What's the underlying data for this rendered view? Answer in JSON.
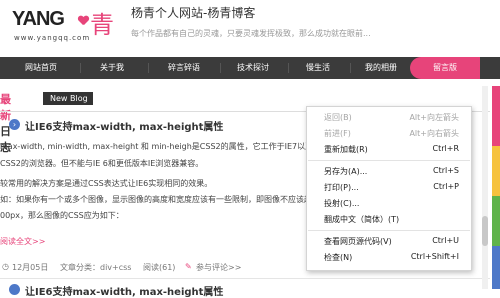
{
  "header": {
    "logo_text": "YANG",
    "logo_char": "青",
    "logo_url": "www.yangqq.com",
    "title": "杨青个人网站-杨青博客",
    "subtitle": "每个作品都有自己的灵魂，只要灵魂发挥极致，那么成功就在眼前..."
  },
  "nav": {
    "items": [
      "网站首页",
      "关于我",
      "碎言碎语",
      "技术探讨",
      "慢生活",
      "我的相册",
      "留言版"
    ],
    "active_index": 6,
    "active_color": "#e7447a"
  },
  "section": {
    "title_pink": "最新",
    "title_dark": "日志",
    "title_en": "New Blog"
  },
  "post": {
    "title": "让IE6支持max-width, max-height属性",
    "lines": [
      "max-width, min-width, max-height 和 min-heigh是CSS2的属性，它工作于IE7以及更高",
      "CSS2的浏览器。但不能与IE 6和更低版本IE浏览器兼容。",
      "较常用的解决方案是通过CSS表达式让IE6实现相同的效果。",
      "如：如果你有一个或多个图像，显示图像的高度和宽度应该有一些限制，即图像不应该超",
      "00px，那么图像的CSS应为如下："
    ],
    "read_more": "阅读全文>>",
    "meta": {
      "date": "12月05日",
      "category": "文章分类：div+css",
      "views": "阅读(61)",
      "comments": "参与评论>>"
    },
    "next_title": "让IE6支持max-width, max-height属性"
  },
  "context_menu": {
    "items": [
      {
        "label": "返回(B)",
        "shortcut": "Alt+向左箭头",
        "disabled": true
      },
      {
        "label": "前进(F)",
        "shortcut": "Alt+向右箭头",
        "disabled": true
      },
      {
        "label": "重新加载(R)",
        "shortcut": "Ctrl+R",
        "disabled": false
      },
      {
        "label": "另存为(A)...",
        "shortcut": "Ctrl+S",
        "disabled": false
      },
      {
        "label": "打印(P)...",
        "shortcut": "Ctrl+P",
        "disabled": false
      },
      {
        "label": "投射(C)...",
        "shortcut": "",
        "disabled": false
      },
      {
        "label": "翻成中文（简体）(T)",
        "shortcut": "",
        "disabled": false
      },
      {
        "label": "查看网页源代码(V)",
        "shortcut": "Ctrl+U",
        "disabled": false
      },
      {
        "label": "检查(N)",
        "shortcut": "Ctrl+Shift+I",
        "disabled": false
      }
    ]
  },
  "side_strip_colors": [
    "#e7447a",
    "#f6c23e",
    "#5fb34a",
    "#4d78c8"
  ]
}
